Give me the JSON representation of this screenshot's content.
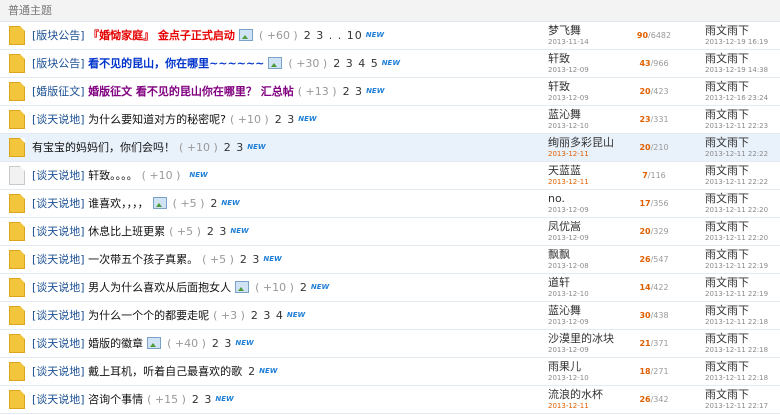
{
  "section_title": "普通主题",
  "rows": [
    {
      "category": "[版块公告]",
      "subject": "『婚恸家庭』 金点子正式启动",
      "style": "red",
      "has_image": true,
      "reply_hint": "( +60 )",
      "pages": "2 3 . . 10",
      "new": "NEW",
      "author": "梦飞舞",
      "date": "2013-11-14",
      "date_red": false,
      "replies": "90",
      "views": "/6482",
      "last_author": "雨文雨下",
      "last_date": "2013-12-19 16:19",
      "icon": "folder",
      "highlight": false
    },
    {
      "category": "[版块公告]",
      "subject": "看不见的昆山，你在哪里~~~~~~",
      "style": "blue",
      "has_image": true,
      "reply_hint": "( +30 )",
      "pages": "2 3 4 5",
      "new": "NEW",
      "author": "轩致",
      "date": "2013-12-09",
      "date_red": false,
      "replies": "43",
      "views": "/966",
      "last_author": "雨文雨下",
      "last_date": "2013-12-19 14:38",
      "icon": "folder",
      "highlight": false
    },
    {
      "category": "[婚版征文]",
      "subject": "婚版征文 看不见的昆山你在哪里？ 汇总帖",
      "style": "purple",
      "has_image": false,
      "reply_hint": "( +13 )",
      "pages": "2 3",
      "new": "NEW",
      "author": "轩致",
      "date": "2013-12-09",
      "date_red": false,
      "replies": "20",
      "views": "/423",
      "last_author": "雨文雨下",
      "last_date": "2013-12-16 23:24",
      "icon": "folder",
      "highlight": false
    },
    {
      "category": "[谈天说地]",
      "subject": "为什么要知道对方的秘密呢?",
      "style": "normal",
      "has_image": false,
      "reply_hint": "( +10 )",
      "pages": "2 3",
      "new": "NEW",
      "author": "蓝沁舞",
      "date": "2013-12-10",
      "date_red": false,
      "replies": "23",
      "views": "/331",
      "last_author": "雨文雨下",
      "last_date": "2013-12-11 22:23",
      "icon": "folder",
      "highlight": false
    },
    {
      "category": "",
      "subject": "有宝宝的妈妈们，你们会吗！",
      "style": "normal",
      "has_image": false,
      "reply_hint": "( +10 )",
      "pages": "2 3",
      "new": "NEW",
      "author": "绚丽多彩昆山",
      "date": "2013-12-11",
      "date_red": true,
      "replies": "20",
      "views": "/210",
      "last_author": "雨文雨下",
      "last_date": "2013-12-11 22:22",
      "icon": "folder",
      "highlight": true
    },
    {
      "category": "[谈天说地]",
      "subject": "轩致。。。。",
      "style": "normal",
      "has_image": false,
      "reply_hint": "( +10 )",
      "pages": "",
      "new": "NEW",
      "author": "天蓝蓝",
      "date": "2013-12-11",
      "date_red": true,
      "replies": "7",
      "views": "/116",
      "last_author": "雨文雨下",
      "last_date": "2013-12-11 22:22",
      "icon": "plain",
      "highlight": false
    },
    {
      "category": "[谈天说地]",
      "subject": "谁喜欢，，，，",
      "style": "normal",
      "has_image": true,
      "reply_hint": "( +5 )",
      "pages": "2",
      "new": "NEW",
      "author": "no.",
      "date": "2013-12-09",
      "date_red": false,
      "replies": "17",
      "views": "/356",
      "last_author": "雨文雨下",
      "last_date": "2013-12-11 22:20",
      "icon": "folder",
      "highlight": false
    },
    {
      "category": "[谈天说地]",
      "subject": "休息比上班更累",
      "style": "normal",
      "has_image": false,
      "reply_hint": "( +5 )",
      "pages": "2 3",
      "new": "NEW",
      "author": "凤优嵩",
      "date": "2013-12-09",
      "date_red": false,
      "replies": "20",
      "views": "/329",
      "last_author": "雨文雨下",
      "last_date": "2013-12-11 22:20",
      "icon": "folder",
      "highlight": false
    },
    {
      "category": "[谈天说地]",
      "subject": "一次带五个孩子真累。",
      "style": "normal",
      "has_image": false,
      "reply_hint": "( +5 )",
      "pages": "2 3",
      "new": "NEW",
      "author": "飘飘",
      "date": "2013-12-08",
      "date_red": false,
      "replies": "26",
      "views": "/547",
      "last_author": "雨文雨下",
      "last_date": "2013-12-11 22:19",
      "icon": "folder",
      "highlight": false
    },
    {
      "category": "[谈天说地]",
      "subject": "男人为什么喜欢从后面抱女人",
      "style": "normal",
      "has_image": true,
      "reply_hint": "( +10 )",
      "pages": "2",
      "new": "NEW",
      "author": "道轩",
      "date": "2013-12-10",
      "date_red": false,
      "replies": "14",
      "views": "/422",
      "last_author": "雨文雨下",
      "last_date": "2013-12-11 22:19",
      "icon": "folder",
      "highlight": false
    },
    {
      "category": "[谈天说地]",
      "subject": "为什么一个个的都要走呢",
      "style": "normal",
      "has_image": false,
      "reply_hint": "( +3 )",
      "pages": "2 3 4",
      "new": "NEW",
      "author": "蓝沁舞",
      "date": "2013-12-09",
      "date_red": false,
      "replies": "30",
      "views": "/438",
      "last_author": "雨文雨下",
      "last_date": "2013-12-11 22:18",
      "icon": "folder",
      "highlight": false
    },
    {
      "category": "[谈天说地]",
      "subject": "婚版的徽章",
      "style": "normal",
      "has_image": true,
      "reply_hint": "( +40 )",
      "pages": "2 3",
      "new": "NEW",
      "author": "沙漠里的冰块",
      "date": "2013-12-09",
      "date_red": false,
      "replies": "21",
      "views": "/371",
      "last_author": "雨文雨下",
      "last_date": "2013-12-11 22:18",
      "icon": "folder",
      "highlight": false
    },
    {
      "category": "[谈天说地]",
      "subject": "戴上耳机，听着自己最喜欢的歌",
      "style": "normal",
      "has_image": false,
      "reply_hint": "",
      "pages": "2",
      "new": "NEW",
      "author": "雨果儿",
      "date": "2013-12-10",
      "date_red": false,
      "replies": "18",
      "views": "/271",
      "last_author": "雨文雨下",
      "last_date": "2013-12-11 22:18",
      "icon": "folder",
      "highlight": false
    },
    {
      "category": "[谈天说地]",
      "subject": "咨询个事情",
      "style": "normal",
      "has_image": false,
      "reply_hint": "( +15 )",
      "pages": "2 3",
      "new": "NEW",
      "author": "流浪的水杯",
      "date": "2013-12-11",
      "date_red": true,
      "replies": "26",
      "views": "/342",
      "last_author": "雨文雨下",
      "last_date": "2013-12-11 22:17",
      "icon": "folder",
      "highlight": false
    }
  ]
}
